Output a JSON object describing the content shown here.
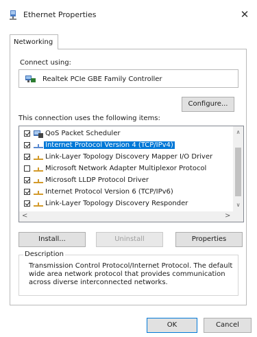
{
  "window": {
    "title": "Ethernet Properties",
    "close_glyph": "✕"
  },
  "tabs": [
    {
      "label": "Networking",
      "active": true
    }
  ],
  "connect": {
    "label": "Connect using:",
    "adapter": "Realtek PCIe GBE Family Controller",
    "configure_label": "Configure..."
  },
  "items": {
    "label": "This connection uses the following items:",
    "list": [
      {
        "label": "QoS Packet Scheduler",
        "checked": true,
        "icon": "scheduler-icon",
        "selected": false
      },
      {
        "label": "Internet Protocol Version 4 (TCP/IPv4)",
        "checked": true,
        "icon": "protocol-icon",
        "selected": true
      },
      {
        "label": "Link-Layer Topology Discovery Mapper I/O Driver",
        "checked": true,
        "icon": "protocol-icon",
        "selected": false
      },
      {
        "label": "Microsoft Network Adapter Multiplexor Protocol",
        "checked": false,
        "icon": "protocol-icon",
        "selected": false
      },
      {
        "label": "Microsoft LLDP Protocol Driver",
        "checked": true,
        "icon": "protocol-icon",
        "selected": false
      },
      {
        "label": "Internet Protocol Version 6 (TCP/IPv6)",
        "checked": true,
        "icon": "protocol-icon",
        "selected": false
      },
      {
        "label": "Link-Layer Topology Discovery Responder",
        "checked": true,
        "icon": "protocol-icon",
        "selected": false
      }
    ]
  },
  "actions": {
    "install_label": "Install...",
    "uninstall_label": "Uninstall",
    "properties_label": "Properties"
  },
  "description": {
    "title": "Description",
    "text": "Transmission Control Protocol/Internet Protocol. The default wide area network protocol that provides communication across diverse interconnected networks."
  },
  "footer": {
    "ok_label": "OK",
    "cancel_label": "Cancel"
  },
  "colors": {
    "selection": "#0078d7",
    "button_face": "#e1e1e1",
    "border": "#adadad"
  }
}
